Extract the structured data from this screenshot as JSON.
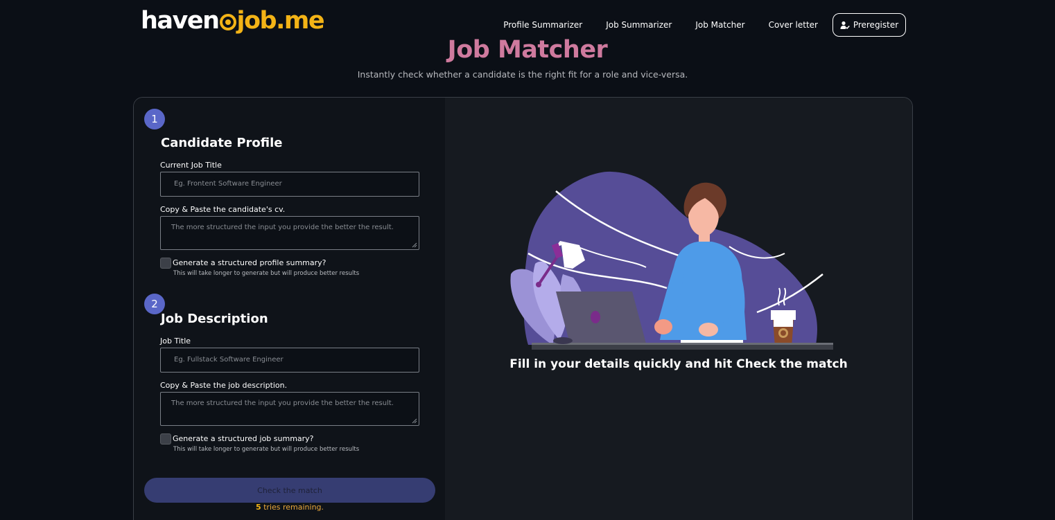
{
  "brand": {
    "logo_left": "haven",
    "logo_right": "job.me"
  },
  "nav": {
    "items": [
      "Profile Summarizer",
      "Job Summarizer",
      "Job Matcher",
      "Cover letter"
    ],
    "preregister": "Preregister"
  },
  "hero": {
    "title": "Job Matcher",
    "subtitle": "Instantly check whether a candidate is the right fit for a role and vice-versa."
  },
  "candidate": {
    "step": "1",
    "title": "Candidate Profile",
    "job_title_label": "Current Job Title",
    "job_title_placeholder": "Eg. Frontent Software Engineer",
    "cv_label": "Copy & Paste the candidate's cv.",
    "cv_placeholder": "The more structured the input you provide the better the result.",
    "summary_label": "Generate a structured profile summary?",
    "summary_hint": "This will take longer to generate but will produce better results"
  },
  "job": {
    "step": "2",
    "title": "Job Description",
    "job_title_label": "Job Title",
    "job_title_placeholder": "Eg. Fullstack Software Engineer",
    "desc_label": "Copy & Paste the job description.",
    "desc_placeholder": "The more structured the input you provide the better the result.",
    "summary_label": "Generate a structured job summary?",
    "summary_hint": "This will take longer to generate but will produce better results"
  },
  "action": {
    "button": "Check the match",
    "tries_count": "5",
    "tries_text": " tries remaining."
  },
  "panel": {
    "caption": "Fill in your details quickly and hit Check the match"
  },
  "colors": {
    "accent": "#5a67c8",
    "brand_gold": "#f3b316",
    "title_pink": "#cf7a9e",
    "background": "#0b0f16"
  }
}
